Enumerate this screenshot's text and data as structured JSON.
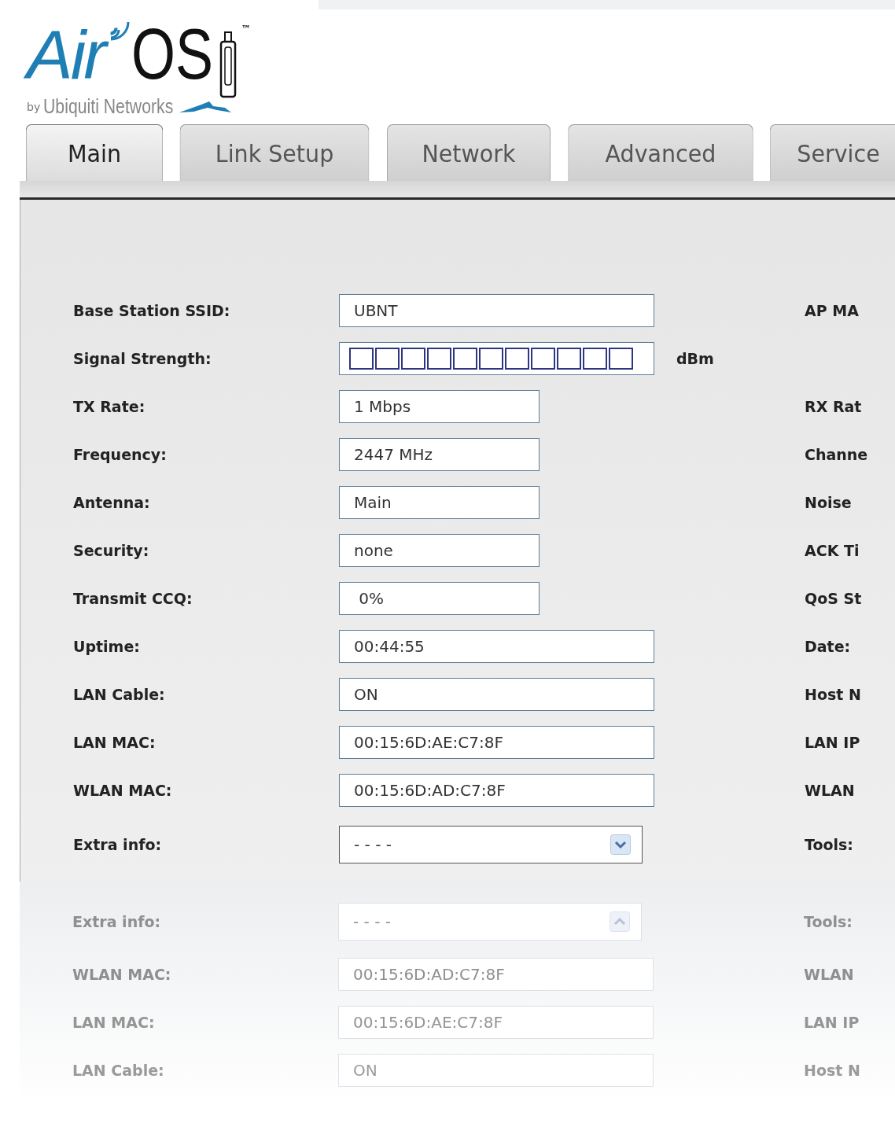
{
  "logo": {
    "brand_a": "Air",
    "brand_b": "OS",
    "trademark": "™",
    "byline": "by",
    "company": "Ubiquiti Networks"
  },
  "tabs": [
    {
      "label": "Main",
      "selected": true
    },
    {
      "label": "Link Setup",
      "selected": false
    },
    {
      "label": "Network",
      "selected": false
    },
    {
      "label": "Advanced",
      "selected": false
    },
    {
      "label": "Service",
      "selected": false
    }
  ],
  "rows": [
    {
      "label": "Base Station SSID:",
      "kind": "wide",
      "value": "UBNT",
      "right_label": "AP MA"
    },
    {
      "label": "Signal Strength:",
      "kind": "signal",
      "unit": "dBm"
    },
    {
      "label": "TX Rate:",
      "kind": "narrow",
      "value": "1 Mbps",
      "right_label": "RX Rat"
    },
    {
      "label": "Frequency:",
      "kind": "narrow",
      "value": "2447 MHz",
      "right_label": "Channe"
    },
    {
      "label": "Antenna:",
      "kind": "narrow",
      "value": "Main",
      "right_label": "Noise"
    },
    {
      "label": "Security:",
      "kind": "narrow",
      "value": "none",
      "right_label": "ACK Ti"
    },
    {
      "label": "Transmit CCQ:",
      "kind": "narrow",
      "value": " 0%",
      "right_label": "QoS St"
    },
    {
      "label": "Uptime:",
      "kind": "wide",
      "value": "00:44:55",
      "right_label": "Date:"
    },
    {
      "label": "LAN Cable:",
      "kind": "wide",
      "value": "ON",
      "right_label": "Host N"
    },
    {
      "label": "LAN MAC:",
      "kind": "wide",
      "value": "00:15:6D:AE:C7:8F",
      "right_label": "LAN IP"
    },
    {
      "label": "WLAN MAC:",
      "kind": "wide",
      "value": "00:15:6D:AD:C7:8F",
      "right_label": "WLAN"
    },
    {
      "label": "Extra info:",
      "kind": "select",
      "value": "- - - -",
      "right_label": "Tools:"
    }
  ],
  "reflection": [
    {
      "label": "Extra info:",
      "kind": "select",
      "value": "- - - -",
      "right_label": "Tools:"
    },
    {
      "label": "WLAN MAC:",
      "kind": "wide",
      "value": "00:15:6D:AD:C7:8F",
      "right_label": "WLAN"
    },
    {
      "label": "LAN MAC:",
      "kind": "wide",
      "value": "00:15:6D:AE:C7:8F",
      "right_label": "LAN IP"
    },
    {
      "label": "LAN Cable:",
      "kind": "wide",
      "value": "ON",
      "right_label": "Host N"
    }
  ]
}
